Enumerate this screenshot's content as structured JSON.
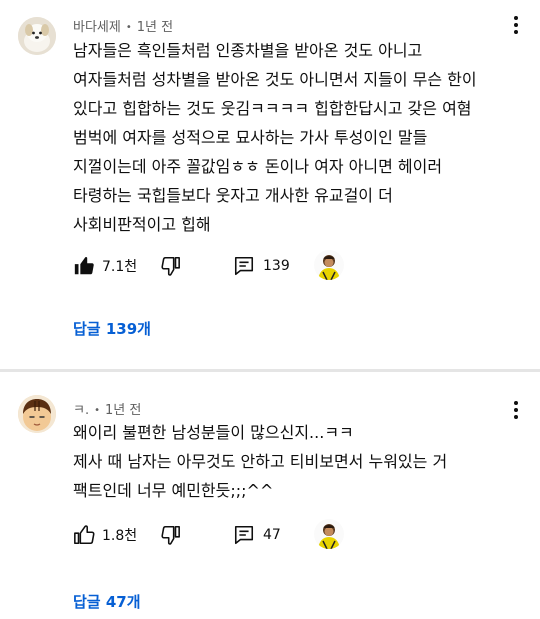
{
  "comments": [
    {
      "author": "바다세제",
      "time": "1년 전",
      "lines": [
        "남자들은 흑인들처럼 인종차별을 받아온 것도 아니고",
        "여자들처럼 성차별을 받아온 것도 아니면서 지들이 무슨 한이",
        "있다고 힙합하는 것도 웃김ㅋㅋㅋㅋ 힙합한답시고 갖은 여혐",
        "범벅에 여자를 성적으로 묘사하는 가사 투성이인 말들",
        "지껄이는데 아주 꼴값임ㅎㅎ 돈이나 여자 아니면 헤이러",
        "타령하는 국힙들보다 웃자고 개사한 유교걸이 더",
        "사회비판적이고 힙해"
      ],
      "likes": "7.1천",
      "reply_count": "139",
      "replies_link": "답글 139개",
      "liked": true
    },
    {
      "author": "ㅋ.",
      "time": "1년 전",
      "lines": [
        "왜이리 불편한 남성분들이 많으신지...ㅋㅋ",
        "제사 때 남자는 아무것도 안하고 티비보면서 누워있는 거",
        "팩트인데 너무 예민한듯;;;^^"
      ],
      "likes": "1.8천",
      "reply_count": "47",
      "replies_link": "답글 47개",
      "liked": false
    }
  ],
  "meta_separator": "•",
  "icons": {
    "like": "thumbs-up-icon",
    "dislike": "thumbs-down-icon",
    "reply": "reply-comment-icon",
    "more": "more-vert-icon",
    "creator": "creator-heart-avatar"
  },
  "colors": {
    "link": "#065fd4",
    "meta": "#606060",
    "text": "#0f0f0f",
    "creator_yellow": "#e8d400"
  }
}
